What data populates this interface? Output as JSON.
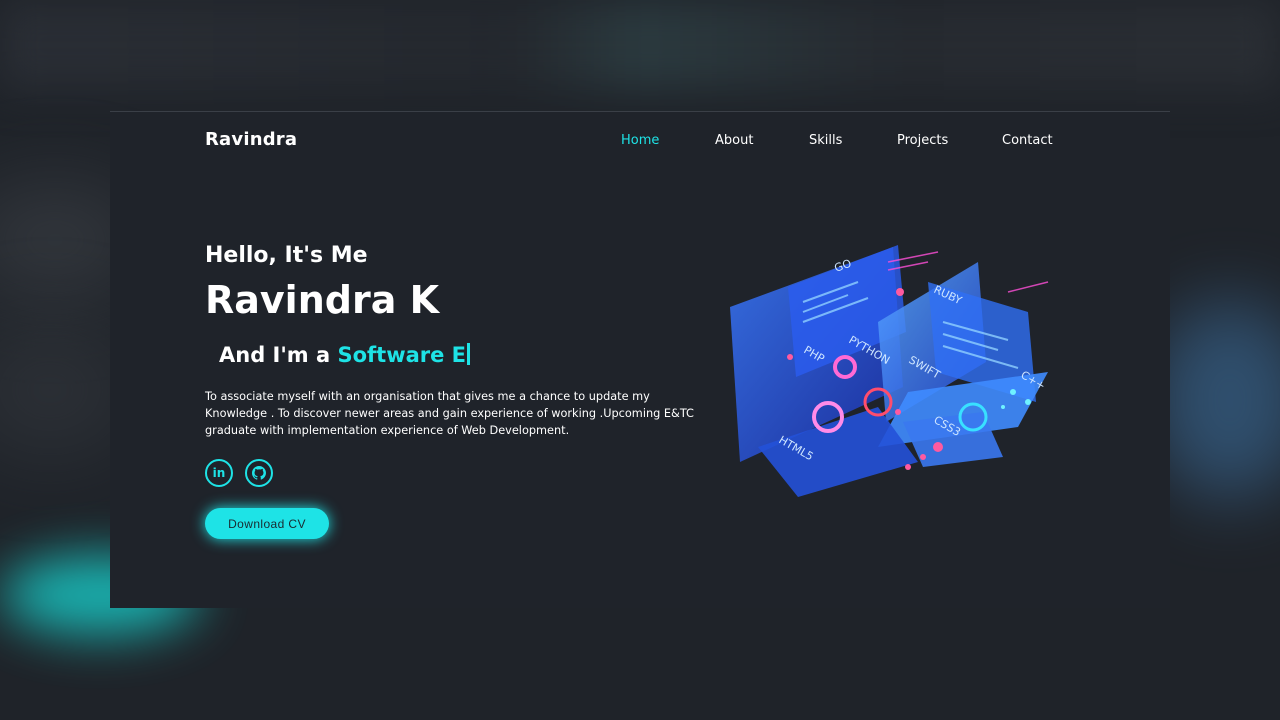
{
  "brand": "Ravindra",
  "nav": {
    "items": [
      {
        "label": "Home",
        "active": true
      },
      {
        "label": "About",
        "active": false
      },
      {
        "label": "Skills",
        "active": false
      },
      {
        "label": "Projects",
        "active": false
      },
      {
        "label": "Contact",
        "active": false
      }
    ]
  },
  "hero": {
    "greeting": "Hello, It's Me",
    "name": "Ravindra K",
    "role_prefix": "And I'm a",
    "role_typed": "Software E",
    "bio": "To associate myself with an organisation that gives me a chance to update my Knowledge . To discover newer areas and gain experience of working .Upcoming E&TC graduate with implementation experience of Web Development.",
    "socials": [
      {
        "icon": "linkedin-icon",
        "glyph": "in"
      },
      {
        "icon": "github-icon",
        "glyph": "⌥"
      }
    ],
    "cta_label": "Download CV"
  },
  "illustration": {
    "labels": [
      "GO",
      "RUBY",
      "PHP",
      "PYTHON",
      "SWIFT",
      "C++",
      "CSS3",
      "HTML5"
    ]
  },
  "colors": {
    "accent": "#1ee3e6",
    "background": "#1f232a"
  }
}
